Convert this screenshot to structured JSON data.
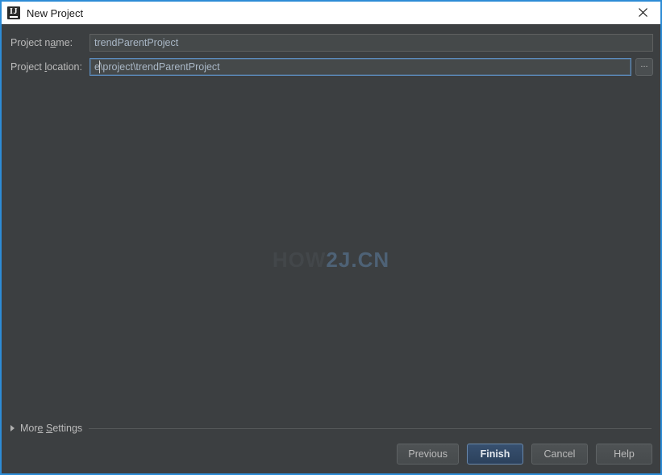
{
  "window": {
    "title": "New Project",
    "app_icon": "intellij-idea-icon",
    "close_icon": "close-icon",
    "focus_border_color": "#2d8cd6",
    "background_color": "#3c3f41"
  },
  "form": {
    "project_name": {
      "label": "Project name:",
      "label_mnemonic": "a",
      "value": "trendParentProject",
      "focused": false
    },
    "project_location": {
      "label": "Project location:",
      "label_mnemonic": "l",
      "value": "e\\project\\trendParentProject",
      "focused": true,
      "browse_label": "..."
    }
  },
  "watermark": {
    "part_a": "HOW",
    "part_b": "2J.CN",
    "color_a": "#43474a",
    "color_b": "#4e6276"
  },
  "more_settings": {
    "label": "More Settings",
    "expanded": false,
    "chevron_icon": "triangle-right-icon"
  },
  "buttons": [
    {
      "name": "previous-button",
      "label": "Previous",
      "primary": false
    },
    {
      "name": "finish-button",
      "label": "Finish",
      "primary": true
    },
    {
      "name": "cancel-button",
      "label": "Cancel",
      "primary": false
    },
    {
      "name": "help-button",
      "label": "Help",
      "primary": false
    }
  ]
}
